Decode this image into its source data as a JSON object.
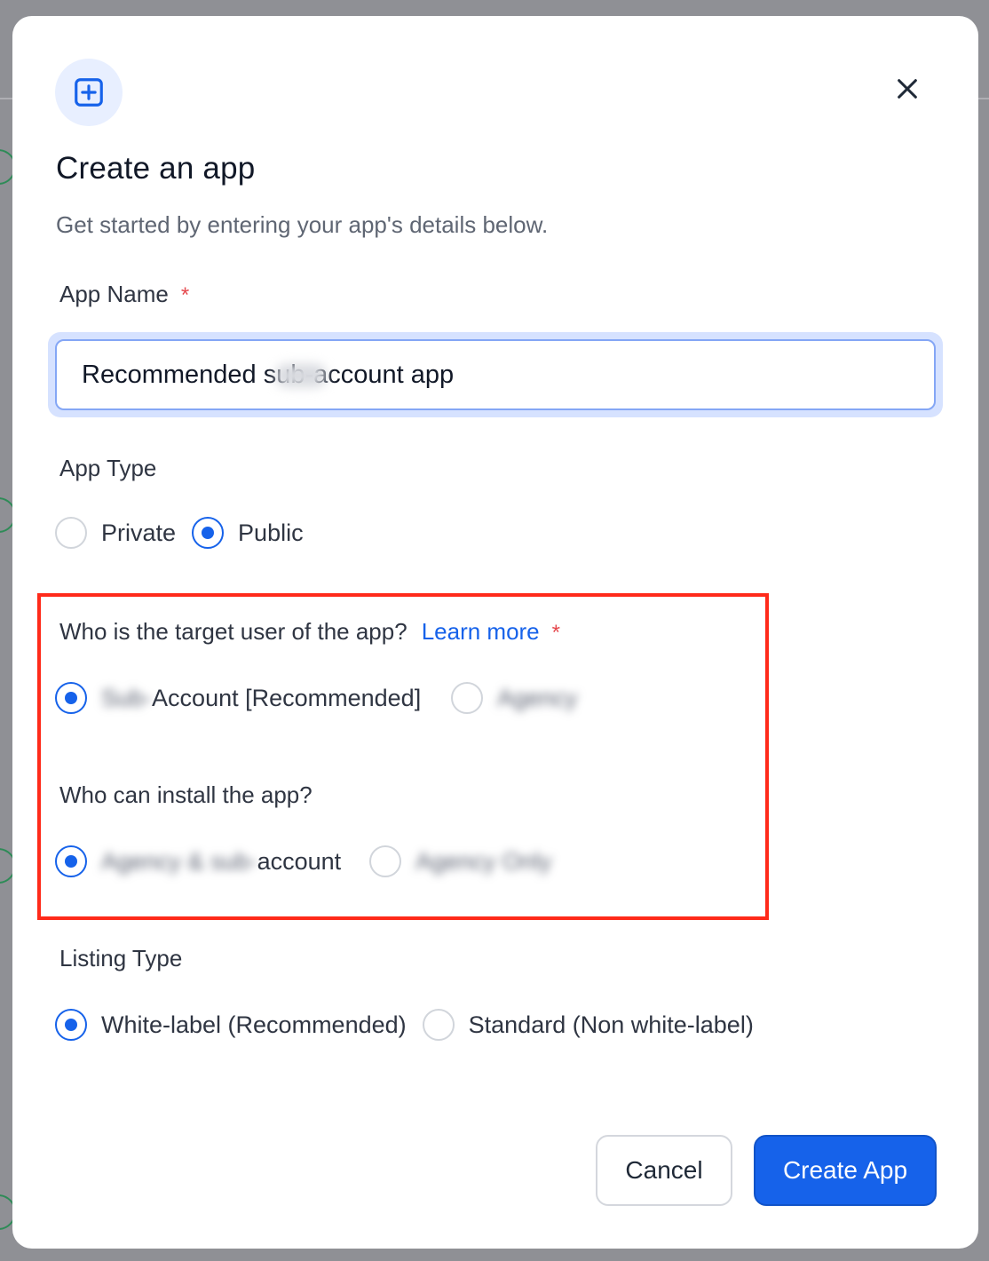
{
  "modal": {
    "title": "Create an app",
    "subtitle": "Get started by entering your app's details below.",
    "close_icon": "close-icon",
    "header_icon": "plus-square-icon"
  },
  "app_name": {
    "label": "App Name",
    "required_mark": "*",
    "value": "Recommended sub-account app"
  },
  "app_type": {
    "label": "App Type",
    "options": [
      {
        "label": "Private",
        "checked": false
      },
      {
        "label": "Public",
        "checked": true
      }
    ]
  },
  "target_user": {
    "question": "Who is the target user of the app?",
    "learn_more": "Learn more",
    "required_mark": "*",
    "options": [
      {
        "blurred_prefix": "Sub-",
        "label": "Account [Recommended]",
        "checked": true
      },
      {
        "blurred_label": "Agency",
        "checked": false
      }
    ]
  },
  "install_scope": {
    "question": "Who can install the app?",
    "options": [
      {
        "blurred_prefix": "Agency & sub-",
        "label": "account",
        "checked": true
      },
      {
        "blurred_label": "Agency Only",
        "checked": false
      }
    ]
  },
  "listing_type": {
    "label": "Listing Type",
    "options": [
      {
        "label": "White-label (Recommended)",
        "checked": true
      },
      {
        "label": "Standard (Non white-label)",
        "checked": false
      }
    ]
  },
  "footer": {
    "cancel_label": "Cancel",
    "create_label": "Create App"
  },
  "colors": {
    "primary": "#1662ea",
    "highlight": "#ff2a1a",
    "required": "#e5484d"
  }
}
